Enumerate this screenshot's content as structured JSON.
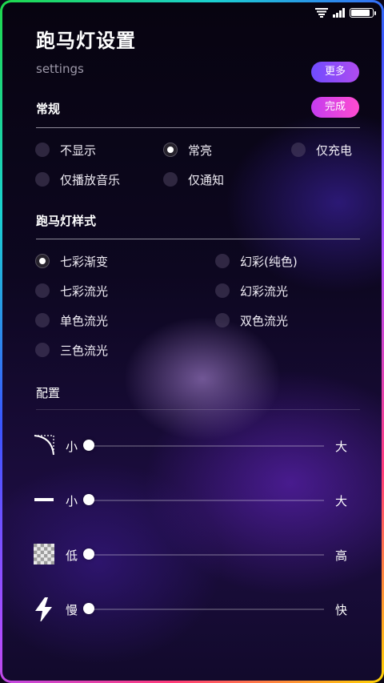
{
  "header": {
    "title": "跑马灯设置",
    "subtitle": "settings",
    "more_label": "更多",
    "done_label": "完成"
  },
  "general": {
    "title": "常规",
    "options": [
      {
        "label": "不显示",
        "checked": false
      },
      {
        "label": "常亮",
        "checked": true
      },
      {
        "label": "仅充电",
        "checked": false
      },
      {
        "label": "仅播放音乐",
        "checked": false
      },
      {
        "label": "仅通知",
        "checked": false
      }
    ]
  },
  "style": {
    "title": "跑马灯样式",
    "options": [
      {
        "label": "七彩渐变",
        "checked": true
      },
      {
        "label": "幻彩(纯色)",
        "checked": false
      },
      {
        "label": "七彩流光",
        "checked": false
      },
      {
        "label": "幻彩流光",
        "checked": false
      },
      {
        "label": "单色流光",
        "checked": false
      },
      {
        "label": "双色流光",
        "checked": false
      },
      {
        "label": "三色流光",
        "checked": false
      }
    ]
  },
  "config": {
    "title": "配置",
    "sliders": [
      {
        "icon": "corner-radius-icon",
        "low": "小",
        "high": "大",
        "value": 0
      },
      {
        "icon": "line-width-icon",
        "low": "小",
        "high": "大",
        "value": 0
      },
      {
        "icon": "transparency-icon",
        "low": "低",
        "high": "高",
        "value": 0
      },
      {
        "icon": "lightning-icon",
        "low": "慢",
        "high": "快",
        "value": 0
      }
    ]
  },
  "status": {
    "battery_level": 0.95
  },
  "colors": {
    "more_button": "#8a4cf8",
    "done_button": "#e03ce0",
    "accent_frame": "#3a55ff"
  }
}
